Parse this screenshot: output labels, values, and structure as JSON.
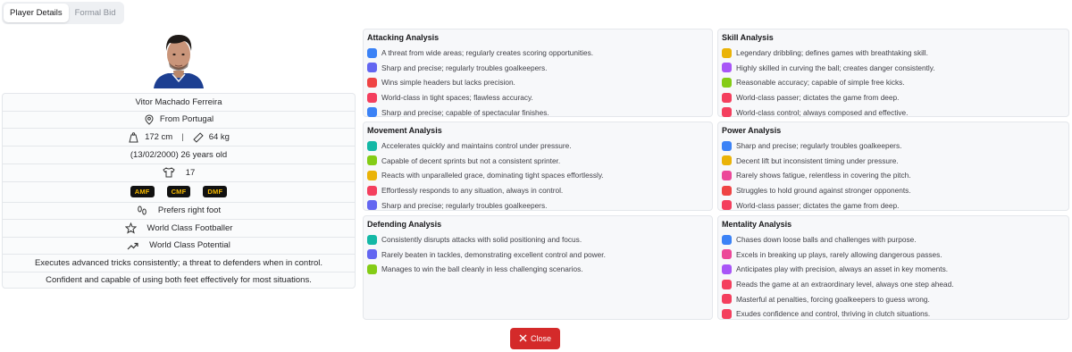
{
  "tabs": [
    "Player Details",
    "Formal Bid"
  ],
  "player": {
    "name": "Vitor Machado Ferreira",
    "origin": "From Portugal",
    "height": "172 cm",
    "separator": "|",
    "weight": "64 kg",
    "dob": "(13/02/2000) 26 years old",
    "shirt": "17",
    "positions": [
      "AMF",
      "CMF",
      "DMF"
    ],
    "foot": "Prefers right foot",
    "level": "World Class Footballer",
    "potential": "World Class Potential",
    "trait1": "Executes advanced tricks consistently; a threat to defenders when in control.",
    "trait2": "Confident and capable of using both feet effectively for most situations."
  },
  "colors": {
    "blue": "#3b82f6",
    "indigo": "#6366f1",
    "red": "#ef4444",
    "crimson": "#f43f5e",
    "yellow": "#eab308",
    "purple": "#a855f7",
    "green": "#84cc16",
    "teal": "#14b8a6",
    "pink": "#ec4899",
    "close": "#d42a2a"
  },
  "analysis": {
    "attacking": {
      "title": "Attacking Analysis",
      "items": [
        {
          "text": "A threat from wide areas; regularly creates scoring opportunities.",
          "color": "#3b82f6"
        },
        {
          "text": "Sharp and precise; regularly troubles goalkeepers.",
          "color": "#6366f1"
        },
        {
          "text": "Wins simple headers but lacks precision.",
          "color": "#ef4444"
        },
        {
          "text": "World-class in tight spaces; flawless accuracy.",
          "color": "#f43f5e"
        },
        {
          "text": "Sharp and precise; capable of spectacular finishes.",
          "color": "#3b82f6"
        }
      ]
    },
    "skill": {
      "title": "Skill Analysis",
      "items": [
        {
          "text": "Legendary dribbling; defines games with breathtaking skill.",
          "color": "#eab308"
        },
        {
          "text": "Highly skilled in curving the ball; creates danger consistently.",
          "color": "#a855f7"
        },
        {
          "text": "Reasonable accuracy; capable of simple free kicks.",
          "color": "#84cc16"
        },
        {
          "text": "World-class passer; dictates the game from deep.",
          "color": "#f43f5e"
        },
        {
          "text": "World-class control; always composed and effective.",
          "color": "#f43f5e"
        }
      ]
    },
    "movement": {
      "title": "Movement Analysis",
      "items": [
        {
          "text": "Accelerates quickly and maintains control under pressure.",
          "color": "#14b8a6"
        },
        {
          "text": "Capable of decent sprints but not a consistent sprinter.",
          "color": "#84cc16"
        },
        {
          "text": "Reacts with unparalleled grace, dominating tight spaces effortlessly.",
          "color": "#eab308"
        },
        {
          "text": "Effortlessly responds to any situation, always in control.",
          "color": "#f43f5e"
        },
        {
          "text": "Sharp and precise; regularly troubles goalkeepers.",
          "color": "#6366f1"
        }
      ]
    },
    "power": {
      "title": "Power Analysis",
      "items": [
        {
          "text": "Sharp and precise; regularly troubles goalkeepers.",
          "color": "#3b82f6"
        },
        {
          "text": "Decent lift but inconsistent timing under pressure.",
          "color": "#eab308"
        },
        {
          "text": "Rarely shows fatigue, relentless in covering the pitch.",
          "color": "#ec4899"
        },
        {
          "text": "Struggles to hold ground against stronger opponents.",
          "color": "#ef4444"
        },
        {
          "text": "World-class passer; dictates the game from deep.",
          "color": "#f43f5e"
        }
      ]
    },
    "defending": {
      "title": "Defending Analysis",
      "items": [
        {
          "text": "Consistently disrupts attacks with solid positioning and focus.",
          "color": "#14b8a6"
        },
        {
          "text": "Rarely beaten in tackles, demonstrating excellent control and power.",
          "color": "#6366f1"
        },
        {
          "text": "Manages to win the ball cleanly in less challenging scenarios.",
          "color": "#84cc16"
        }
      ]
    },
    "mentality": {
      "title": "Mentality Analysis",
      "items": [
        {
          "text": "Chases down loose balls and challenges with purpose.",
          "color": "#3b82f6"
        },
        {
          "text": "Excels in breaking up plays, rarely allowing dangerous passes.",
          "color": "#ec4899"
        },
        {
          "text": "Anticipates play with precision, always an asset in key moments.",
          "color": "#a855f7"
        },
        {
          "text": "Reads the game at an extraordinary level, always one step ahead.",
          "color": "#f43f5e"
        },
        {
          "text": "Masterful at penalties, forcing goalkeepers to guess wrong.",
          "color": "#f43f5e"
        },
        {
          "text": "Exudes confidence and control, thriving in clutch situations.",
          "color": "#f43f5e"
        }
      ]
    }
  },
  "close_label": "Close"
}
